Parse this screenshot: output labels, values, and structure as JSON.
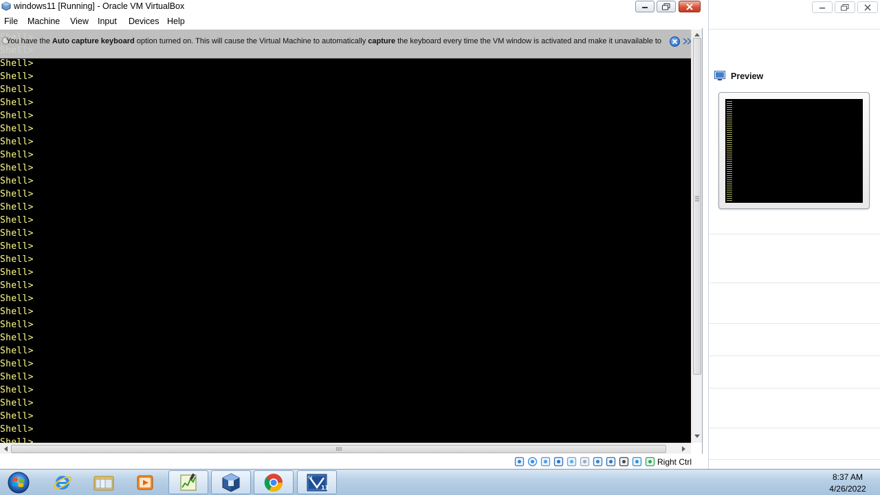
{
  "window": {
    "title": "windows11 [Running] - Oracle VM VirtualBox"
  },
  "menu": {
    "items": [
      {
        "label": "File"
      },
      {
        "label": "Machine"
      },
      {
        "label": "View"
      },
      {
        "label": "Input"
      },
      {
        "label": "Devices"
      },
      {
        "label": "Help"
      }
    ]
  },
  "banner": {
    "text_1": "You have the ",
    "bold_1": "Auto capture keyboard",
    "text_2": " option turned on. This will cause the Virtual Machine to automatically ",
    "bold_2": "capture",
    "text_3": " the keyboard every time the VM window is activated and make it unavailable to"
  },
  "terminal": {
    "prompt": "Shell>",
    "line_count": 32
  },
  "statusbar": {
    "host_key": "Right Ctrl",
    "icons": [
      "hard-disk-icon",
      "optical-drive-icon",
      "audio-icon",
      "network-icon",
      "usb-icon",
      "shared-folders-icon",
      "display-icon",
      "video-capture-icon",
      "virtualization-icon",
      "mouse-integration-icon",
      "keyboard-icon"
    ]
  },
  "manager": {
    "preview_title": "Preview"
  },
  "taskbar": {
    "apps": [
      "internet-explorer",
      "file-explorer",
      "media-player",
      "task-manager",
      "virtualbox",
      "chrome",
      "windows11-vm"
    ],
    "time": "8:37 AM",
    "date": "4/26/2022"
  },
  "colors": {
    "terminal_text": "#ffff8c",
    "terminal_bg": "#000000",
    "banner_bg": "#cdcdcd"
  }
}
